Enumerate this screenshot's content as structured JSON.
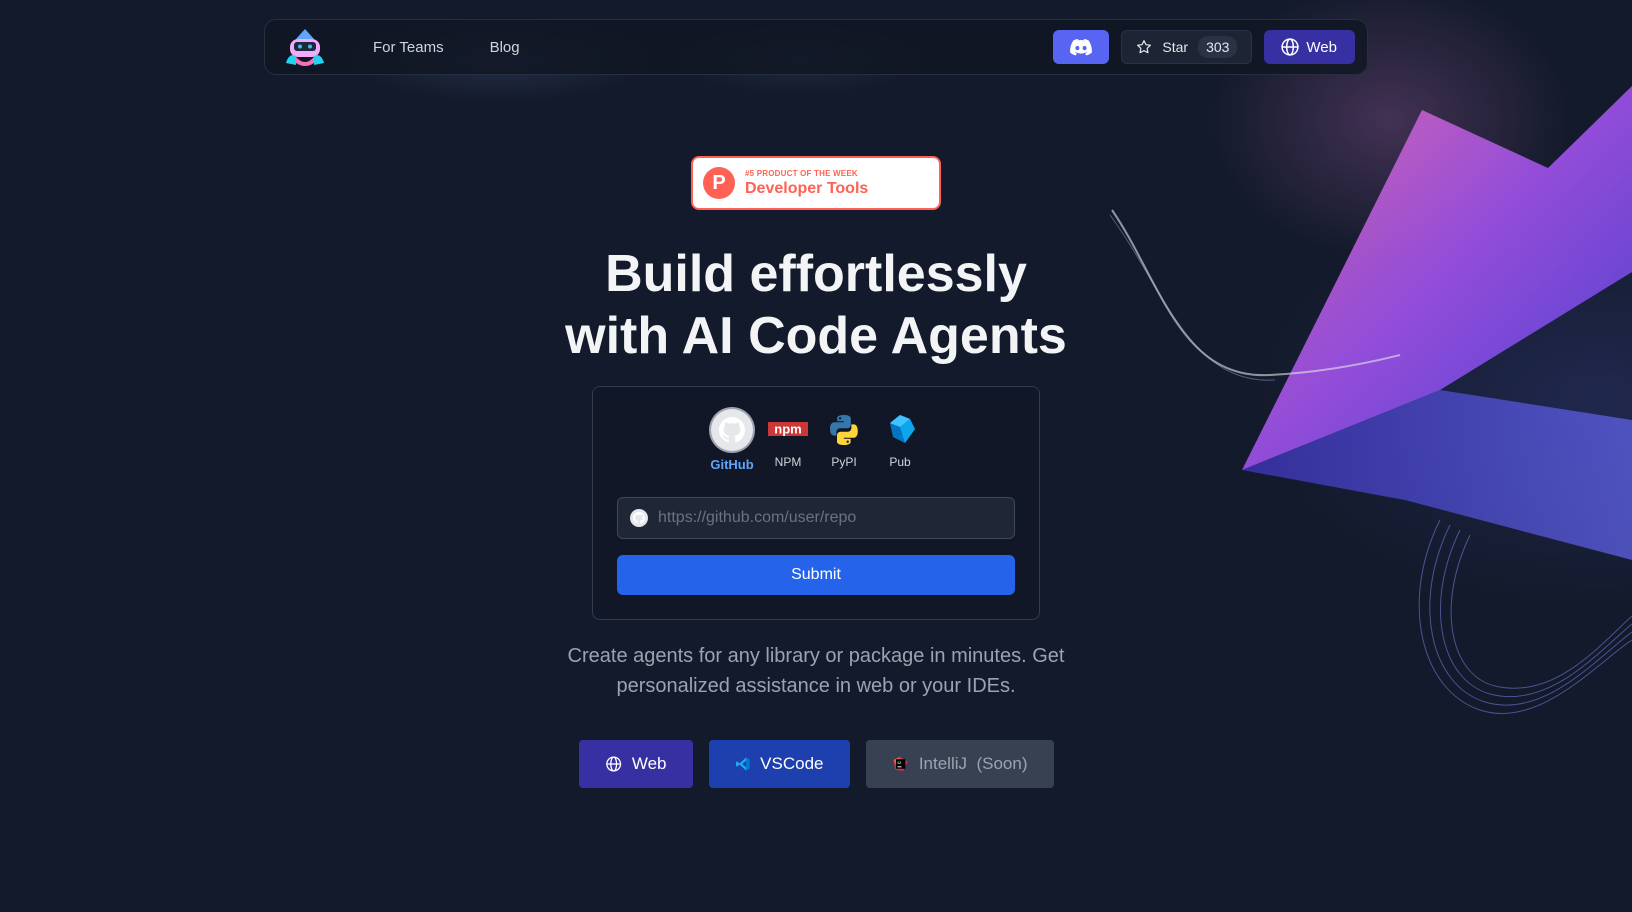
{
  "nav": {
    "links": [
      "For Teams",
      "Blog"
    ],
    "star_label": "Star",
    "star_count": "303",
    "web_label": "Web"
  },
  "badge": {
    "letter": "P",
    "small": "#5 PRODUCT OF THE WEEK",
    "big": "Developer Tools"
  },
  "hero": {
    "line1": "Build effortlessly",
    "line2": "with AI Code Agents"
  },
  "sources": [
    {
      "label": "GitHub",
      "icon": "github-icon",
      "active": true
    },
    {
      "label": "NPM",
      "icon": "npm-icon"
    },
    {
      "label": "PyPI",
      "icon": "python-icon"
    },
    {
      "label": "Pub",
      "icon": "dart-icon"
    }
  ],
  "repo_input": {
    "placeholder": "https://github.com/user/repo",
    "value": ""
  },
  "submit_label": "Submit",
  "subtitle": {
    "line1": "Create agents for any library or package in minutes. Get",
    "line2": "personalized assistance in web or your IDEs."
  },
  "cta": {
    "web": "Web",
    "vscode": "VSCode",
    "intellij": "IntelliJ  (Soon)"
  },
  "colors": {
    "background": "#131a2b",
    "primary_blue": "#2563eb",
    "indigo": "#3730a3",
    "discord": "#5865f2",
    "producthunt": "#ff6154"
  }
}
